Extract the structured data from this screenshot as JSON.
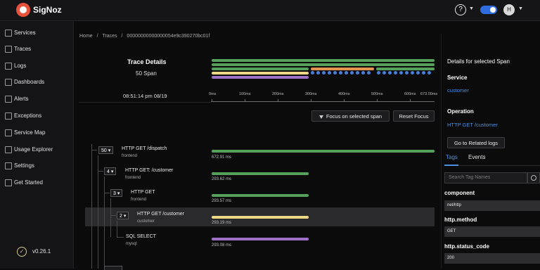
{
  "app": {
    "name": "SigNoz",
    "version": "v0.26.1"
  },
  "header": {
    "help_icon": "?",
    "user_initial": "H",
    "theme_toggle": "dark"
  },
  "sidebar": {
    "items": [
      {
        "label": "Services",
        "icon": "bar-chart-icon"
      },
      {
        "label": "Traces",
        "icon": "traces-icon"
      },
      {
        "label": "Logs",
        "icon": "logs-icon"
      },
      {
        "label": "Dashboards",
        "icon": "dashboard-icon"
      },
      {
        "label": "Alerts",
        "icon": "alert-icon"
      },
      {
        "label": "Exceptions",
        "icon": "bug-icon"
      },
      {
        "label": "Service Map",
        "icon": "map-icon"
      },
      {
        "label": "Usage Explorer",
        "icon": "line-chart-icon"
      },
      {
        "label": "Settings",
        "icon": "gear-icon"
      },
      {
        "label": "Get Started",
        "icon": "rocket-icon"
      }
    ]
  },
  "breadcrumb": [
    "Home",
    "/",
    "Traces",
    "/",
    "00000000000000054e9c390270bc01f"
  ],
  "trace": {
    "title": "Trace Details",
    "span_count": "50 Span",
    "timestamp": "08:51:14 pm 08/19",
    "ticks": [
      "0ms",
      "100ms",
      "200ms",
      "300ms",
      "400ms",
      "500ms",
      "600ms",
      "673.00ms"
    ]
  },
  "actions": {
    "focus": "Focus on selected span",
    "reset": "Reset Focus"
  },
  "spans": [
    {
      "count": "50",
      "name": "HTTP GET /dispatch",
      "service": "frontend",
      "duration": "672.91 ms",
      "color": "#55a15c"
    },
    {
      "count": "4",
      "name": "HTTP GET: /customer",
      "service": "frontend",
      "duration": "293.62 ms",
      "color": "#55a15c"
    },
    {
      "count": "3",
      "name": "HTTP GET",
      "service": "frontend",
      "duration": "293.57 ms",
      "color": "#55a15c"
    },
    {
      "count": "2",
      "name": "HTTP GET /customer",
      "service": "customer",
      "duration": "293.19 ms",
      "color": "#ecd785"
    },
    {
      "count": "",
      "name": "SQL SELECT",
      "service": "mysql",
      "duration": "293.08 ms",
      "color": "#a070c9"
    }
  ],
  "details": {
    "title": "Details for selected Span",
    "service_label": "Service",
    "service_value": "customer",
    "operation_label": "Operation",
    "operation_value": "HTTP GET /customer",
    "related_logs": "Go to Related logs",
    "tabs": [
      "Tags",
      "Events"
    ],
    "search_placeholder": "Search Tag Names",
    "tags": [
      {
        "key": "component",
        "value": "net/http"
      },
      {
        "key": "http.method",
        "value": "GET"
      },
      {
        "key": "http.status_code",
        "value": "200"
      }
    ]
  },
  "colors": {
    "accent": "#4b8fe0",
    "green": "#55a15c",
    "yellow": "#ecd785",
    "purple": "#a070c9",
    "orange": "#e0944f",
    "blue": "#4a7fd9"
  }
}
